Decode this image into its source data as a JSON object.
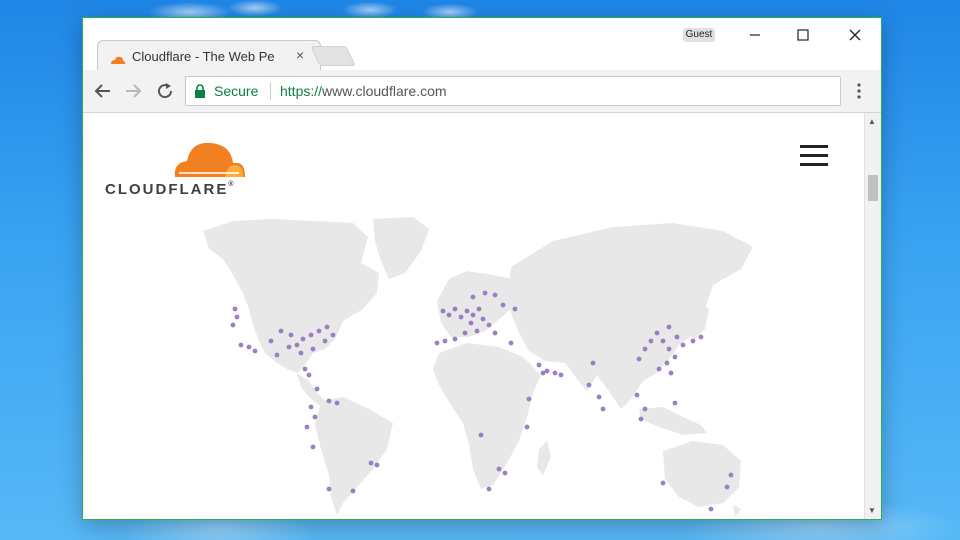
{
  "browser": {
    "tab": {
      "title": "Cloudflare - The Web Pe",
      "favicon": "cloudflare-cloud-icon",
      "close_glyph": "×"
    },
    "user_badge": "Guest",
    "window_controls": {
      "minimize": "—",
      "maximize": "☐",
      "close": "✕"
    },
    "omnibox": {
      "secure_label": "Secure",
      "url_scheme": "https://",
      "url_host": "www.cloudflare.com"
    }
  },
  "page": {
    "brand_name": "CLOUDFLARE",
    "brand_trademark": "®",
    "accent_orange": "#f38020",
    "accent_light_orange": "#faae40",
    "map_land_color": "#e8e8e8",
    "map_dot_color": "#9d7ec4"
  },
  "icons": {
    "back": "back-arrow-icon",
    "forward": "forward-arrow-icon",
    "reload": "reload-icon",
    "lock": "lock-icon",
    "menu": "kebab-menu-icon",
    "hamburger": "hamburger-menu-icon"
  }
}
